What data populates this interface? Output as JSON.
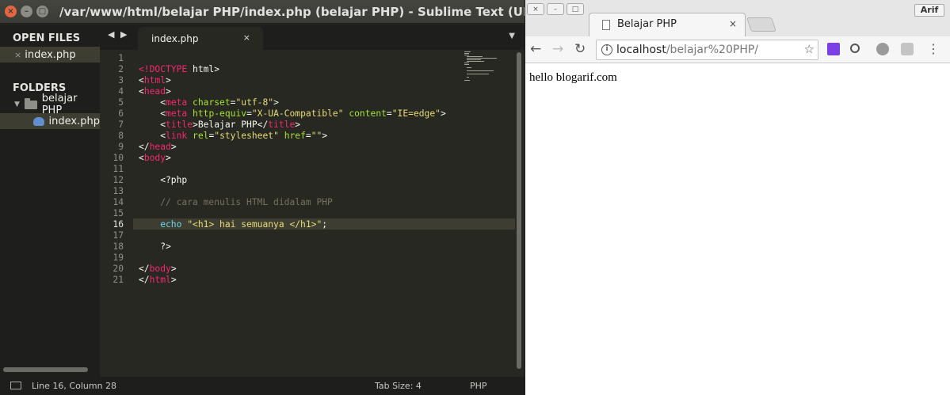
{
  "sublime": {
    "title": "/var/www/html/belajar PHP/index.php (belajar PHP) - Sublime Text (UNREGISTERED)",
    "window_buttons": [
      "×",
      "–",
      "□"
    ],
    "sidebar": {
      "open_files_header": "OPEN FILES",
      "open_files": [
        {
          "name": "index.php"
        }
      ],
      "folders_header": "FOLDERS",
      "folders": [
        {
          "name": "belajar PHP",
          "files": [
            {
              "name": "index.php"
            }
          ]
        }
      ]
    },
    "tab": {
      "arrows": "◀ ▶",
      "label": "index.php",
      "close": "×",
      "menu": "▼"
    },
    "editor": {
      "current_line": 16,
      "line_numbers": [
        "1",
        "2",
        "3",
        "4",
        "5",
        "6",
        "7",
        "8",
        "9",
        "10",
        "11",
        "12",
        "13",
        "14",
        "15",
        "16",
        "17",
        "18",
        "19",
        "20",
        "21"
      ],
      "lines": [
        [],
        [
          [
            "t",
            "<!"
          ],
          [
            "t",
            "DOCTYPE"
          ],
          [
            "p",
            " html>"
          ]
        ],
        [
          [
            "p",
            "<"
          ],
          [
            "t",
            "html"
          ],
          [
            "p",
            ">"
          ]
        ],
        [
          [
            "p",
            "<"
          ],
          [
            "t",
            "head"
          ],
          [
            "p",
            ">"
          ]
        ],
        [
          [
            "p",
            "    <"
          ],
          [
            "t",
            "meta"
          ],
          [
            "p",
            " "
          ],
          [
            "a",
            "charset"
          ],
          [
            "p",
            "="
          ],
          [
            "s",
            "\"utf-8\""
          ],
          [
            "p",
            ">"
          ]
        ],
        [
          [
            "p",
            "    <"
          ],
          [
            "t",
            "meta"
          ],
          [
            "p",
            " "
          ],
          [
            "a",
            "http-equiv"
          ],
          [
            "p",
            "="
          ],
          [
            "s",
            "\"X-UA-Compatible\""
          ],
          [
            "p",
            " "
          ],
          [
            "a",
            "content"
          ],
          [
            "p",
            "="
          ],
          [
            "s",
            "\"IE=edge\""
          ],
          [
            "p",
            ">"
          ]
        ],
        [
          [
            "p",
            "    <"
          ],
          [
            "t",
            "title"
          ],
          [
            "p",
            ">Belajar PHP</"
          ],
          [
            "t",
            "title"
          ],
          [
            "p",
            ">"
          ]
        ],
        [
          [
            "p",
            "    <"
          ],
          [
            "t",
            "link"
          ],
          [
            "p",
            " "
          ],
          [
            "a",
            "rel"
          ],
          [
            "p",
            "="
          ],
          [
            "s",
            "\"stylesheet\""
          ],
          [
            "p",
            " "
          ],
          [
            "a",
            "href"
          ],
          [
            "p",
            "="
          ],
          [
            "s",
            "\"\""
          ],
          [
            "p",
            ">"
          ]
        ],
        [
          [
            "p",
            "</"
          ],
          [
            "t",
            "head"
          ],
          [
            "p",
            ">"
          ]
        ],
        [
          [
            "p",
            "<"
          ],
          [
            "t",
            "body"
          ],
          [
            "p",
            ">"
          ]
        ],
        [],
        [
          [
            "p",
            "    <?php"
          ]
        ],
        [],
        [
          [
            "c",
            "    // cara menulis HTML didalam PHP"
          ]
        ],
        [],
        [
          [
            "k",
            "    echo"
          ],
          [
            "p",
            " "
          ],
          [
            "s",
            "\"<h1> hai semuanya </h1>\""
          ],
          [
            "p",
            ";"
          ]
        ],
        [],
        [
          [
            "p",
            "    ?>"
          ]
        ],
        [],
        [
          [
            "p",
            "</"
          ],
          [
            "t",
            "body"
          ],
          [
            "p",
            ">"
          ]
        ],
        [
          [
            "p",
            "</"
          ],
          [
            "t",
            "html"
          ],
          [
            "p",
            ">"
          ]
        ]
      ]
    },
    "status": {
      "position": "Line 16, Column 28",
      "tab_size": "Tab Size: 4",
      "syntax": "PHP"
    },
    "colors": {
      "tag": "#f92672",
      "attr": "#a6e22e",
      "string": "#e6db74",
      "comment": "#75715e",
      "keyword": "#66d9ef"
    }
  },
  "chrome": {
    "window_buttons": [
      "×",
      "–",
      "□"
    ],
    "profile": "Arif",
    "tab": {
      "title": "Belajar PHP",
      "close": "×",
      "icon": "page-icon"
    },
    "nav": {
      "back": "←",
      "forward": "→",
      "reload": "↻"
    },
    "omnibox": {
      "info": "i",
      "host": "localhost",
      "path": "/belajar%20PHP/",
      "star": "☆"
    },
    "extensions": [
      "purple-extension-icon",
      "magnifier-icon",
      "globe-icon",
      "gray-extension-icon"
    ],
    "menu": "⋮",
    "page_text": "hello blogarif.com"
  }
}
